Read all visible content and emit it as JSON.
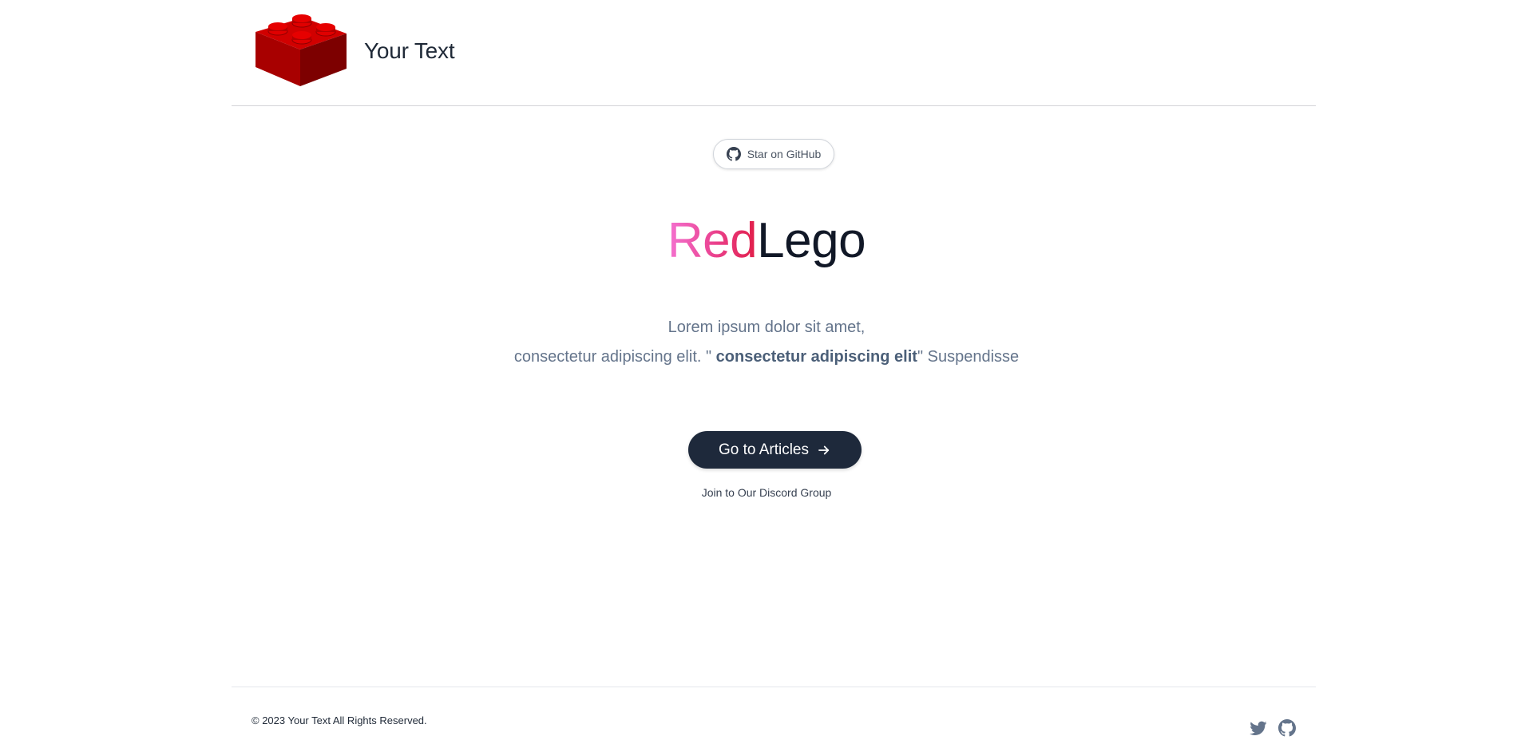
{
  "header": {
    "brand_name": "Your Text",
    "logo_icon": "red-lego-brick"
  },
  "hero": {
    "github_badge_label": "Star on GitHub",
    "title_accent": "Red",
    "title_rest": "Lego",
    "title_gradient": [
      "#f472d0",
      "#ec4899",
      "#e11d48"
    ],
    "description_line1": "Lorem ipsum dolor sit amet,",
    "description_line2_prefix": "consectetur adipiscing elit. \" ",
    "description_line2_bold": "consectetur adipiscing elit",
    "description_line2_suffix": "\" Suspendisse",
    "cta_label": "Go to Articles",
    "cta_icon": "arrow-right",
    "discord_link": "Join to Our Discord Group"
  },
  "footer": {
    "copyright": "© 2023 Your Text All Rights Reserved.",
    "social_icons": [
      "twitter-icon",
      "github-icon"
    ]
  },
  "colors": {
    "cta_background": "#1e293b",
    "text_muted": "#64748b",
    "brick_red": "#c00000"
  }
}
